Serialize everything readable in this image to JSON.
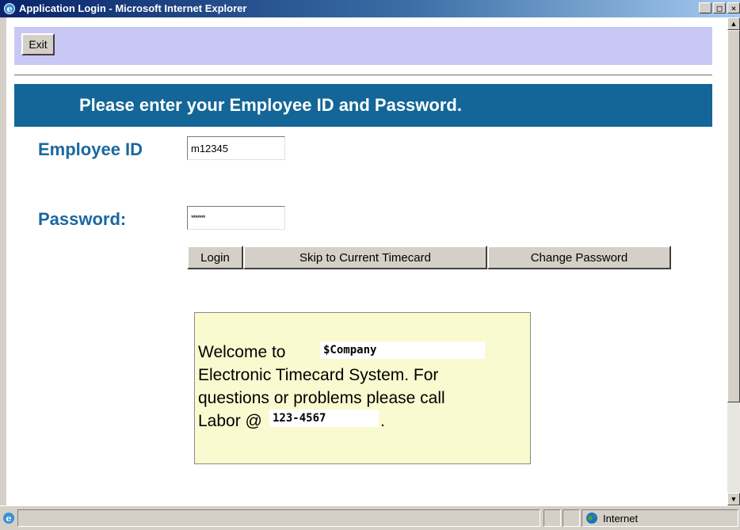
{
  "window": {
    "title": "Application Login - Microsoft Internet Explorer",
    "min": "_",
    "max": "□",
    "close": "×"
  },
  "toolbar": {
    "exit_label": "Exit"
  },
  "banner": {
    "text": "Please enter your Employee ID and Password."
  },
  "form": {
    "employee_id_label": "Employee ID",
    "employee_id_value": "m12345",
    "password_label": "Password:",
    "password_value": "*******"
  },
  "buttons": {
    "login": "Login",
    "skip": "Skip to Current Timecard",
    "change_password": "Change Password"
  },
  "welcome": {
    "line1": "Welcome to",
    "company": "$Company",
    "line2": "Electronic Timecard System. For",
    "line3": "questions or problems please call",
    "line4": "Labor @",
    "phone": "123-4567",
    "period": "."
  },
  "status": {
    "zone": "Internet"
  },
  "colors": {
    "banner": "#136697",
    "label": "#1a68a0",
    "exitbar": "#c9c8f5",
    "welcome_bg": "#fafad0"
  }
}
